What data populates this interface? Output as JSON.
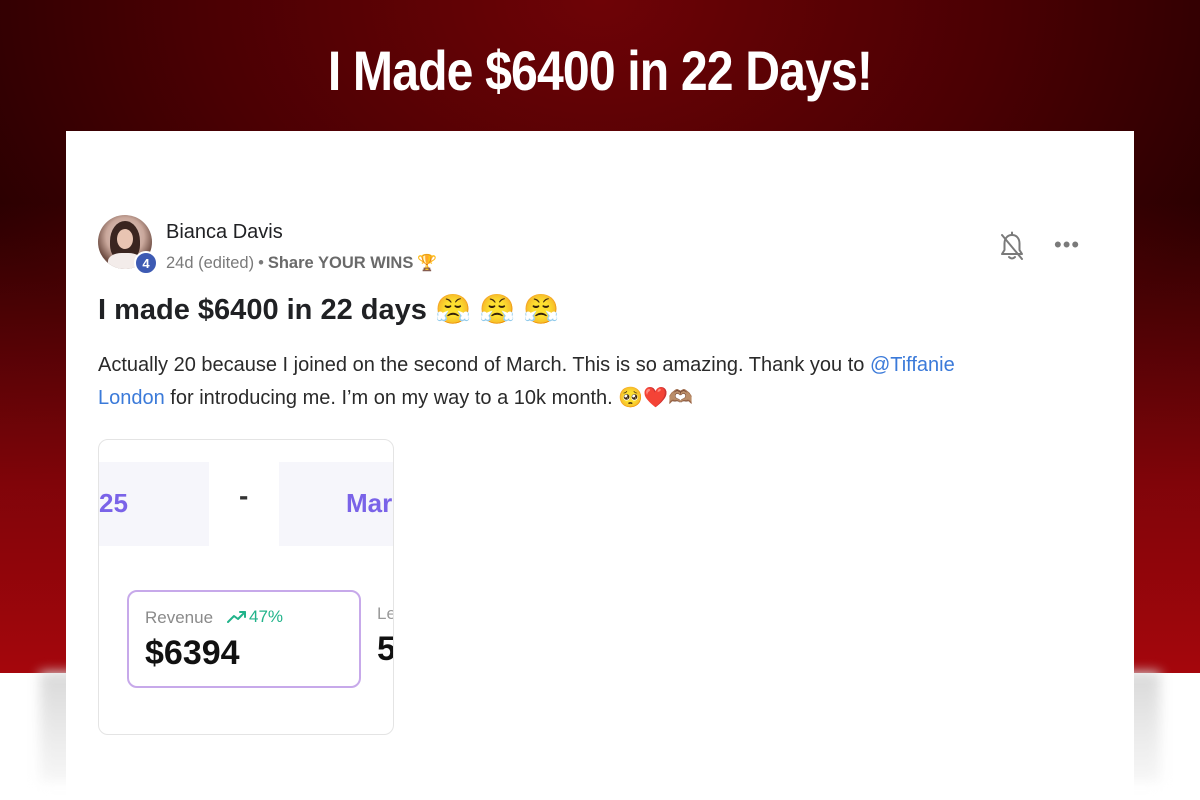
{
  "banner": {
    "headline": "I Made $6400 in 22 Days!",
    "colors": {
      "dark": "#1a0000",
      "red": "#a5060c"
    }
  },
  "post": {
    "author": "Bianca Davis",
    "level": "4",
    "time": "24d (edited)",
    "separator": "•",
    "category": "Share YOUR WINS",
    "category_icon": "🏆",
    "title": "I made $6400 in 22 days",
    "title_emojis": [
      "😤",
      "😤",
      "😤"
    ],
    "body_part1": "Actually 20 because I joined on the second of March. This is so amazing. Thank you to ",
    "mention": "@Tiffanie London",
    "body_part2": " for introducing me. I’m on my way to a 10k month. ",
    "body_emojis": "🥺❤️",
    "body_tail_emojis": "🫶🏽",
    "actions": {
      "bell_icon": "bell-icon",
      "more_icon": "more-icon",
      "more_glyph": "•••"
    }
  },
  "screenshot_image": {
    "date_start": "25",
    "date_dash": "-",
    "date_month": "Mar",
    "revenue_label": "Revenue",
    "revenue_change": "47%",
    "revenue_value": "$6394",
    "side_label": "Le",
    "side_value": "5",
    "accent_color": "#7a63e8",
    "positive_color": "#21b38a"
  }
}
